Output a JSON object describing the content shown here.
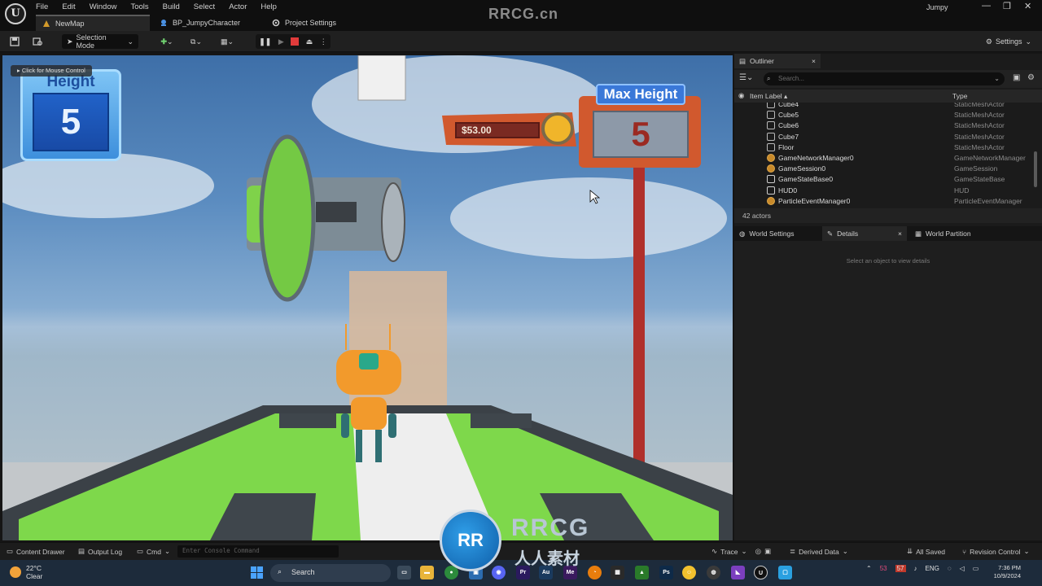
{
  "menu": [
    "File",
    "Edit",
    "Window",
    "Tools",
    "Build",
    "Select",
    "Actor",
    "Help"
  ],
  "tabs": [
    {
      "label": "NewMap"
    },
    {
      "label": "BP_JumpyCharacter"
    },
    {
      "label": "Project Settings"
    }
  ],
  "watermark_top": "RRCG.cn",
  "project_name": "Jumpy",
  "window_controls": {
    "minimize": "—",
    "restore": "❐",
    "close": "✕"
  },
  "toolbar": {
    "selection_mode": "Selection Mode",
    "settings": "Settings"
  },
  "viewport": {
    "mouse_hint": "Click for Mouse Control",
    "hud_height_title": "Height",
    "hud_height_value": "5",
    "coin_label": "$53.00",
    "max_height_title": "Max Height",
    "max_height_value": "5"
  },
  "outliner": {
    "tab": "Outliner",
    "search_placeholder": "Search...",
    "col_label": "Item Label ▴",
    "col_type": "Type",
    "rows": [
      {
        "label": "Cube4",
        "type": "StaticMeshActor",
        "icon": "mesh-icon"
      },
      {
        "label": "Cube5",
        "type": "StaticMeshActor",
        "icon": "mesh-icon"
      },
      {
        "label": "Cube6",
        "type": "StaticMeshActor",
        "icon": "mesh-icon"
      },
      {
        "label": "Cube7",
        "type": "StaticMeshActor",
        "icon": "mesh-icon"
      },
      {
        "label": "Floor",
        "type": "StaticMeshActor",
        "icon": "mesh-icon"
      },
      {
        "label": "GameNetworkManager0",
        "type": "GameNetworkManager",
        "icon": "actor-icon"
      },
      {
        "label": "GameSession0",
        "type": "GameSession",
        "icon": "actor-icon"
      },
      {
        "label": "GameStateBase0",
        "type": "GameStateBase",
        "icon": "image-icon"
      },
      {
        "label": "HUD0",
        "type": "HUD",
        "icon": "hud-icon"
      },
      {
        "label": "ParticleEventManager0",
        "type": "ParticleEventManager",
        "icon": "actor-icon"
      }
    ],
    "actor_count": "42 actors"
  },
  "details": {
    "tab_world": "World Settings",
    "tab_details": "Details",
    "tab_partition": "World Partition",
    "empty_text": "Select an object to view details"
  },
  "statusbar": {
    "content_drawer": "Content Drawer",
    "output_log": "Output Log",
    "cmd": "Cmd",
    "console_placeholder": "Enter Console Command",
    "trace": "Trace",
    "derived_data": "Derived Data",
    "all_saved": "All Saved",
    "revision_control": "Revision Control"
  },
  "taskbar": {
    "temperature": "22°C",
    "weather": "Clear",
    "search": "Search",
    "apps": [
      {
        "label": "Pr",
        "color": "#2a1a5e"
      },
      {
        "label": "Au",
        "color": "#1a3a5e"
      },
      {
        "label": "Me",
        "color": "#3a1a5e"
      },
      {
        "label": "Ps",
        "color": "#0e2a48"
      }
    ],
    "tray_ime": "ENG",
    "badge_a": "53",
    "badge_b": "57",
    "time": "7:36 PM",
    "date": "10/9/2024"
  },
  "watermark_logo": {
    "mark": "RR",
    "text_en": "RRCG",
    "text_cn": "人人素材"
  }
}
